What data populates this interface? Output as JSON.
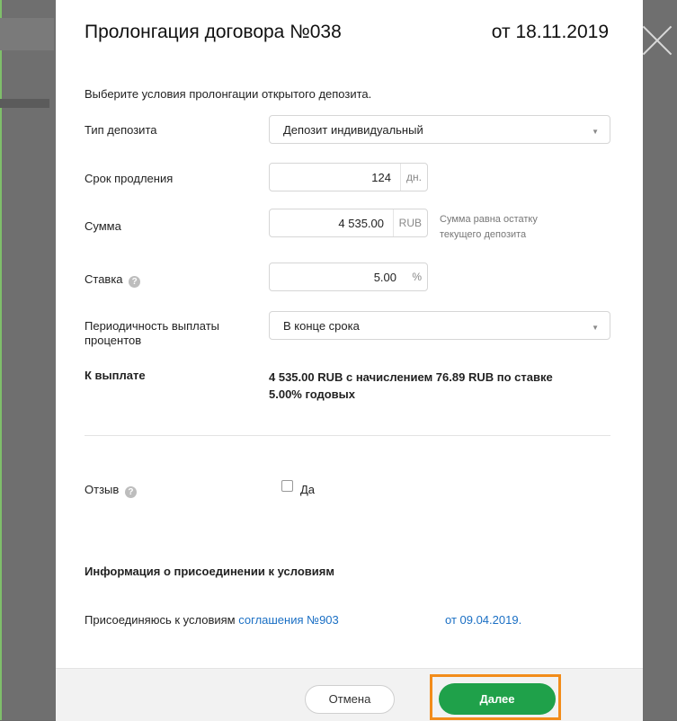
{
  "modal": {
    "title": "Пролонгация договора №038",
    "date": "от 18.11.2019",
    "intro": "Выберите условия пролонгации открытого депозита."
  },
  "form": {
    "deposit_type": {
      "label": "Тип депозита",
      "value": "Депозит индивидуальный"
    },
    "term": {
      "label": "Срок продления",
      "value": "124",
      "unit": "дн."
    },
    "amount": {
      "label": "Сумма",
      "value": "4 535.00",
      "unit": "RUB",
      "hint_line1": "Сумма равна остатку",
      "hint_line2": "текущего депозита"
    },
    "rate": {
      "label": "Ставка",
      "value": "5.00",
      "unit": "%"
    },
    "periodicity": {
      "label_line1": "Периодичность выплаты",
      "label_line2": "процентов",
      "value": "В конце срока"
    },
    "payout": {
      "label": "К выплате",
      "text_line1": "4 535.00 RUB с начислением 76.89 RUB по ставке",
      "text_line2": "5.00% годовых"
    },
    "recall": {
      "label": "Отзыв",
      "checkbox_label": "Да",
      "checked": false
    }
  },
  "info": {
    "title": "Информация о присоединении к условиям",
    "agree_text": "Присоединяюсь к условиям ",
    "agree_link": "соглашения №903",
    "agree_date": "от 09.04.2019."
  },
  "buttons": {
    "cancel": "Отмена",
    "next": "Далее"
  },
  "icons": {
    "help": "?",
    "dropdown": "▼"
  },
  "colors": {
    "accent_green": "#1fa14a",
    "highlight_orange": "#f28c1a",
    "link_blue": "#1a6fc4"
  }
}
